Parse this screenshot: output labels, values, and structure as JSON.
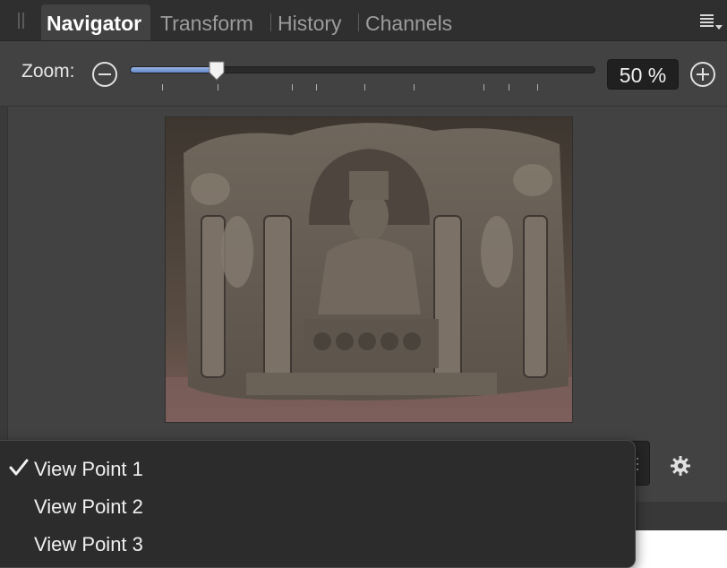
{
  "tabs": [
    {
      "label": "Navigator",
      "active": true
    },
    {
      "label": "Transform",
      "active": false
    },
    {
      "label": "History",
      "active": false
    },
    {
      "label": "Channels",
      "active": false
    }
  ],
  "zoom": {
    "label": "Zoom:",
    "value_text": "50 %",
    "slider_fraction": 0.186
  },
  "view_points": {
    "items": [
      {
        "label": "View Point 1",
        "checked": true
      },
      {
        "label": "View Point 2",
        "checked": false
      },
      {
        "label": "View Point 3",
        "checked": false
      }
    ]
  },
  "colors": {
    "accent": "#6f93d3",
    "panel_bg": "#424242",
    "tabbar_bg": "#2f2f2f",
    "menu_bg": "#2c2c2c"
  },
  "icons": {
    "zoom_out": "minus-circle-icon",
    "zoom_in": "plus-circle-icon",
    "panel_menu": "panel-menu-icon",
    "settings": "gear-icon",
    "checked": "checkmark-icon"
  }
}
